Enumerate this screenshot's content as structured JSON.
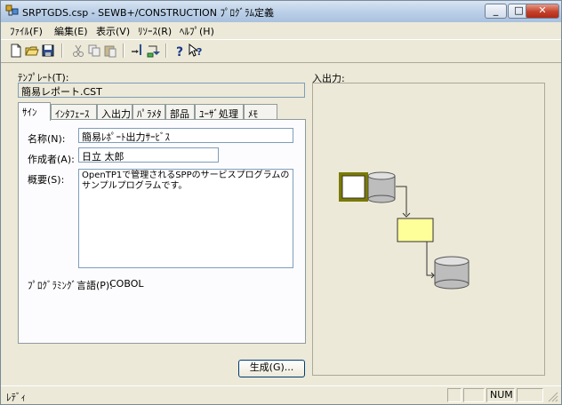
{
  "window": {
    "title": "SRPTGDS.csp - SEWB+/CONSTRUCTION ﾌﾟﾛｸﾞﾗﾑ定義",
    "minimize": "_",
    "maximize": "□",
    "close": "✕"
  },
  "menu": [
    {
      "label": "ﾌｧｲﾙ(F)"
    },
    {
      "label": "編集(E)"
    },
    {
      "label": "表示(V)"
    },
    {
      "label": "ﾘｿｰｽ(R)"
    },
    {
      "label": "ﾍﾙﾌﾟ(H)"
    }
  ],
  "toolbar": {
    "icons": [
      "new-file-icon",
      "open-folder-icon",
      "save-icon",
      "cut-icon",
      "copy-icon",
      "paste-icon",
      "resource-icon",
      "resource-insert-icon",
      "help-icon",
      "context-help-icon"
    ]
  },
  "template": {
    "label": "ﾃﾝﾌﾟﾚｰﾄ(T):",
    "value": "簡易レポート.CST"
  },
  "tabs": [
    {
      "label": "ｻｲﾝ",
      "active": true
    },
    {
      "label": "ｲﾝﾀﾌｪｰｽ"
    },
    {
      "label": "入出力"
    },
    {
      "label": "ﾊﾟﾗﾒﾀ"
    },
    {
      "label": "部品"
    },
    {
      "label": "ﾕｰｻﾞ処理"
    },
    {
      "label": "ﾒﾓ"
    }
  ],
  "form": {
    "name_label": "名称(N):",
    "name_value": "簡易ﾚﾎﾟｰﾄ出力ｻｰﾋﾞｽ",
    "author_label": "作成者(A):",
    "author_value": "日立 太郎",
    "summary_label": "概要(S):",
    "summary_value": "OpenTP1で管理されるSPPのサービスプログラムの\nサンプルプログラムです。",
    "language_label": "ﾌﾟﾛｸﾞﾗﾐﾝｸﾞ言語(P):",
    "language_value": "COBOL"
  },
  "generate_button": "生成(G)...",
  "io": {
    "label": "入出力:"
  },
  "status": {
    "text": "ﾚﾃﾞｨ",
    "num": "NUM"
  }
}
